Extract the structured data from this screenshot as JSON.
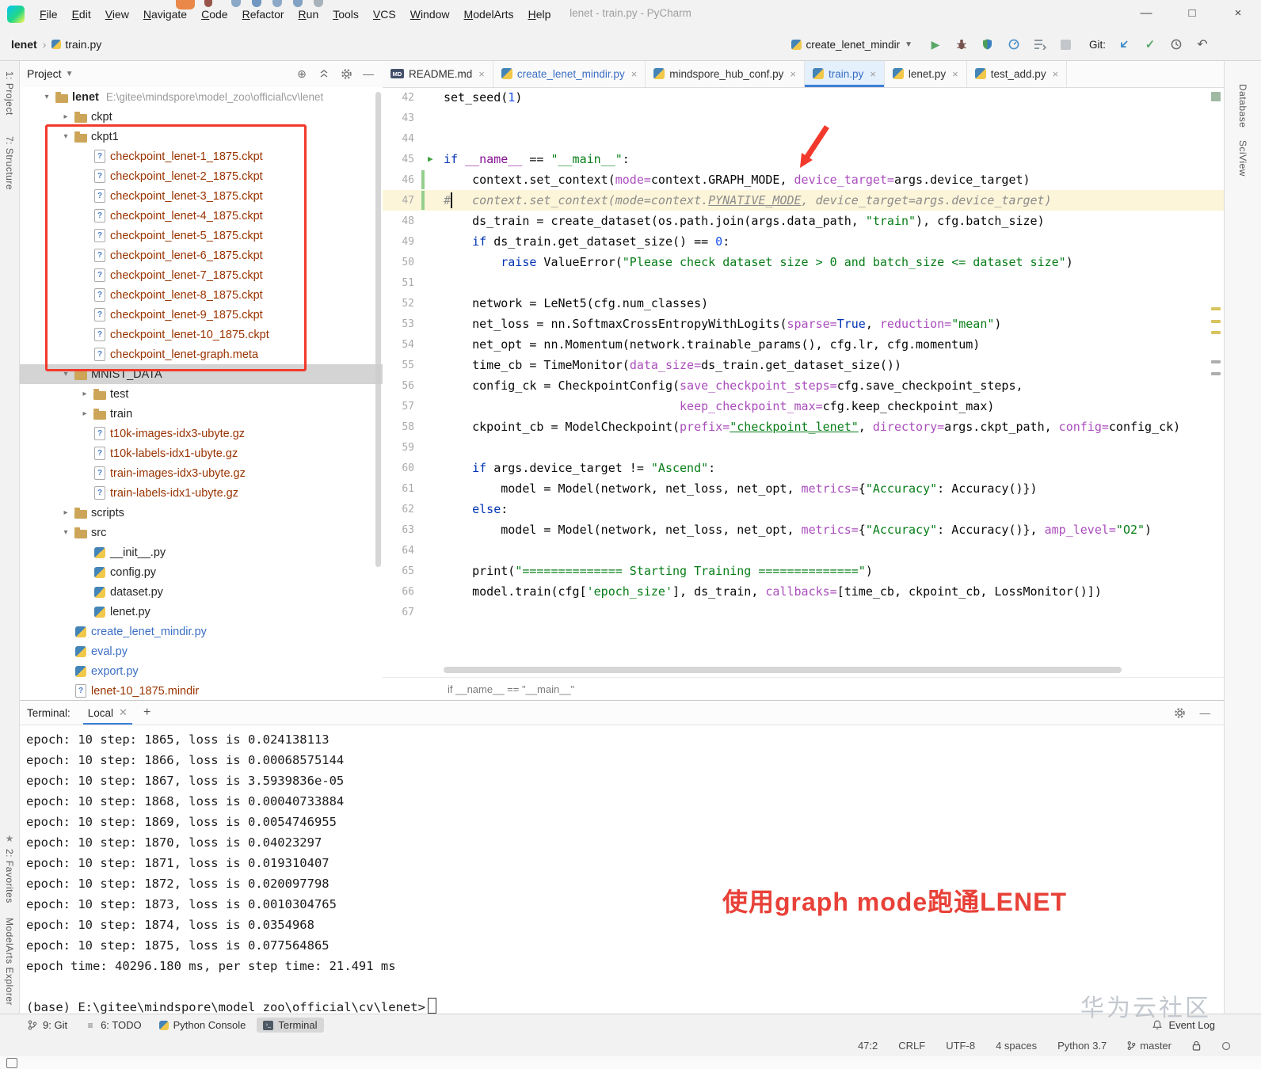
{
  "window": {
    "title": "lenet - train.py - PyCharm",
    "menus": [
      "File",
      "Edit",
      "View",
      "Navigate",
      "Code",
      "Refactor",
      "Run",
      "Tools",
      "VCS",
      "Window",
      "ModelArts",
      "Help"
    ],
    "controls": {
      "minimize": "—",
      "maximize": "□",
      "close": "×"
    }
  },
  "toolbar": {
    "project_crumb": "lenet",
    "file_crumb": "train.py",
    "run_config": "create_lenet_mindir",
    "git_label": "Git:"
  },
  "stripes": {
    "left_top": [
      "1: Project",
      "7: Structure"
    ],
    "left_bottom": [
      "2: Favorites",
      "ModelArts Explorer"
    ],
    "right": [
      "Database",
      "SciView"
    ]
  },
  "project_panel": {
    "title": "Project",
    "tree": [
      {
        "label": "lenet",
        "suffix": "E:\\gitee\\mindspore\\model_zoo\\official\\cv\\lenet",
        "level": 0,
        "icon": "folder",
        "arrow": "down",
        "bold": true
      },
      {
        "label": "ckpt",
        "level": 1,
        "icon": "folder",
        "arrow": "right"
      },
      {
        "label": "ckpt1",
        "level": 1,
        "icon": "folder",
        "arrow": "down"
      },
      {
        "label": "checkpoint_lenet-1_1875.ckpt",
        "level": 2,
        "icon": "fileq",
        "color": "brown"
      },
      {
        "label": "checkpoint_lenet-2_1875.ckpt",
        "level": 2,
        "icon": "fileq",
        "color": "brown"
      },
      {
        "label": "checkpoint_lenet-3_1875.ckpt",
        "level": 2,
        "icon": "fileq",
        "color": "brown"
      },
      {
        "label": "checkpoint_lenet-4_1875.ckpt",
        "level": 2,
        "icon": "fileq",
        "color": "brown"
      },
      {
        "label": "checkpoint_lenet-5_1875.ckpt",
        "level": 2,
        "icon": "fileq",
        "color": "brown"
      },
      {
        "label": "checkpoint_lenet-6_1875.ckpt",
        "level": 2,
        "icon": "fileq",
        "color": "brown"
      },
      {
        "label": "checkpoint_lenet-7_1875.ckpt",
        "level": 2,
        "icon": "fileq",
        "color": "brown"
      },
      {
        "label": "checkpoint_lenet-8_1875.ckpt",
        "level": 2,
        "icon": "fileq",
        "color": "brown"
      },
      {
        "label": "checkpoint_lenet-9_1875.ckpt",
        "level": 2,
        "icon": "fileq",
        "color": "brown"
      },
      {
        "label": "checkpoint_lenet-10_1875.ckpt",
        "level": 2,
        "icon": "fileq",
        "color": "brown"
      },
      {
        "label": "checkpoint_lenet-graph.meta",
        "level": 2,
        "icon": "fileq",
        "color": "brown"
      },
      {
        "label": "MNIST_DATA",
        "level": 1,
        "icon": "folder",
        "arrow": "down",
        "selected": true
      },
      {
        "label": "test",
        "level": 2,
        "icon": "folder",
        "arrow": "right"
      },
      {
        "label": "train",
        "level": 2,
        "icon": "folder",
        "arrow": "right"
      },
      {
        "label": "t10k-images-idx3-ubyte.gz",
        "level": 2,
        "icon": "fileq",
        "color": "brown"
      },
      {
        "label": "t10k-labels-idx1-ubyte.gz",
        "level": 2,
        "icon": "fileq",
        "color": "brown"
      },
      {
        "label": "train-images-idx3-ubyte.gz",
        "level": 2,
        "icon": "fileq",
        "color": "brown"
      },
      {
        "label": "train-labels-idx1-ubyte.gz",
        "level": 2,
        "icon": "fileq",
        "color": "brown"
      },
      {
        "label": "scripts",
        "level": 1,
        "icon": "folder",
        "arrow": "right"
      },
      {
        "label": "src",
        "level": 1,
        "icon": "folder",
        "arrow": "down"
      },
      {
        "label": "__init__.py",
        "level": 2,
        "icon": "py"
      },
      {
        "label": "config.py",
        "level": 2,
        "icon": "py"
      },
      {
        "label": "dataset.py",
        "level": 2,
        "icon": "py"
      },
      {
        "label": "lenet.py",
        "level": 2,
        "icon": "py"
      },
      {
        "label": "create_lenet_mindir.py",
        "level": 1,
        "icon": "py",
        "color": "blue"
      },
      {
        "label": "eval.py",
        "level": 1,
        "icon": "py",
        "color": "blue"
      },
      {
        "label": "export.py",
        "level": 1,
        "icon": "py",
        "color": "blue"
      },
      {
        "label": "lenet-10_1875.mindir",
        "level": 1,
        "icon": "fileq",
        "color": "brown"
      }
    ]
  },
  "editor": {
    "tabs": [
      {
        "label": "README.md",
        "icon": "md",
        "mod": false,
        "active": false
      },
      {
        "label": "create_lenet_mindir.py",
        "icon": "py",
        "mod": true,
        "active": false
      },
      {
        "label": "mindspore_hub_conf.py",
        "icon": "py",
        "mod": false,
        "active": false
      },
      {
        "label": "train.py",
        "icon": "py",
        "mod": true,
        "active": true
      },
      {
        "label": "lenet.py",
        "icon": "py",
        "mod": false,
        "active": false
      },
      {
        "label": "test_add.py",
        "icon": "py",
        "mod": false,
        "active": false
      }
    ],
    "current_line": 47,
    "run_line": 45,
    "changed_lines": [
      46,
      47
    ],
    "breadcrumb": "if __name__ == \"__main__\"",
    "lines": [
      {
        "n": 42,
        "t": [
          [
            "p",
            "set_seed("
          ],
          [
            "n",
            "1"
          ],
          [
            "p",
            ")"
          ]
        ]
      },
      {
        "n": 43,
        "t": []
      },
      {
        "n": 44,
        "t": []
      },
      {
        "n": 45,
        "t": [
          [
            "k",
            "if"
          ],
          [
            "p",
            " "
          ],
          [
            "d",
            "__name__"
          ],
          [
            "p",
            " == "
          ],
          [
            "s",
            "\"__main__\""
          ],
          [
            "p",
            ":"
          ]
        ]
      },
      {
        "n": 46,
        "t": [
          [
            "p",
            "    context.set_context("
          ],
          [
            "a",
            "mode="
          ],
          [
            "p",
            "context.GRAPH_MODE, "
          ],
          [
            "a",
            "device_target="
          ],
          [
            "p",
            "args.device_target)"
          ]
        ]
      },
      {
        "n": 47,
        "t": [
          [
            "c",
            "#   context.set_context(mode=context."
          ],
          [
            "cu",
            "PYNATIVE_MODE"
          ],
          [
            "c",
            ", device_target=args.device_target)"
          ]
        ]
      },
      {
        "n": 48,
        "t": [
          [
            "p",
            "    ds_train = create_dataset(os.path.join(args.data_path, "
          ],
          [
            "s",
            "\"train\""
          ],
          [
            "p",
            "), cfg.batch_size)"
          ]
        ]
      },
      {
        "n": 49,
        "t": [
          [
            "p",
            "    "
          ],
          [
            "k",
            "if"
          ],
          [
            "p",
            " ds_train.get_dataset_size() == "
          ],
          [
            "n",
            "0"
          ],
          [
            "p",
            ":"
          ]
        ]
      },
      {
        "n": 50,
        "t": [
          [
            "p",
            "        "
          ],
          [
            "k",
            "raise"
          ],
          [
            "p",
            " ValueError("
          ],
          [
            "s",
            "\"Please check dataset size > 0 and batch_size <= dataset size\""
          ],
          [
            "p",
            ")"
          ]
        ]
      },
      {
        "n": 51,
        "t": []
      },
      {
        "n": 52,
        "t": [
          [
            "p",
            "    network = LeNet5(cfg.num_classes)"
          ]
        ]
      },
      {
        "n": 53,
        "t": [
          [
            "p",
            "    net_loss = nn.SoftmaxCrossEntropyWithLogits("
          ],
          [
            "a",
            "sparse="
          ],
          [
            "k",
            "True"
          ],
          [
            "p",
            ", "
          ],
          [
            "a",
            "reduction="
          ],
          [
            "s",
            "\"mean\""
          ],
          [
            "p",
            ")"
          ]
        ]
      },
      {
        "n": 54,
        "t": [
          [
            "p",
            "    net_opt = nn.Momentum(network.trainable_params(), cfg.lr, cfg.momentum)"
          ]
        ]
      },
      {
        "n": 55,
        "t": [
          [
            "p",
            "    time_cb = TimeMonitor("
          ],
          [
            "a",
            "data_size="
          ],
          [
            "p",
            "ds_train.get_dataset_size())"
          ]
        ]
      },
      {
        "n": 56,
        "t": [
          [
            "p",
            "    config_ck = CheckpointConfig("
          ],
          [
            "a",
            "save_checkpoint_steps="
          ],
          [
            "p",
            "cfg.save_checkpoint_steps,"
          ]
        ]
      },
      {
        "n": 57,
        "t": [
          [
            "p",
            "                                 "
          ],
          [
            "a",
            "keep_checkpoint_max="
          ],
          [
            "p",
            "cfg.keep_checkpoint_max)"
          ]
        ]
      },
      {
        "n": 58,
        "t": [
          [
            "p",
            "    ckpoint_cb = ModelCheckpoint("
          ],
          [
            "a",
            "prefix="
          ],
          [
            "su",
            "\"checkpoint_lenet\""
          ],
          [
            "p",
            ", "
          ],
          [
            "a",
            "directory="
          ],
          [
            "p",
            "args.ckpt_path, "
          ],
          [
            "a",
            "config="
          ],
          [
            "p",
            "config_ck)"
          ]
        ]
      },
      {
        "n": 59,
        "t": []
      },
      {
        "n": 60,
        "t": [
          [
            "p",
            "    "
          ],
          [
            "k",
            "if"
          ],
          [
            "p",
            " args.device_target != "
          ],
          [
            "s",
            "\"Ascend\""
          ],
          [
            "p",
            ":"
          ]
        ]
      },
      {
        "n": 61,
        "t": [
          [
            "p",
            "        model = Model(network, net_loss, net_opt, "
          ],
          [
            "a",
            "metrics="
          ],
          [
            "p",
            "{"
          ],
          [
            "s",
            "\"Accuracy\""
          ],
          [
            "p",
            ": Accuracy()})"
          ]
        ]
      },
      {
        "n": 62,
        "t": [
          [
            "p",
            "    "
          ],
          [
            "k",
            "else"
          ],
          [
            "p",
            ":"
          ]
        ]
      },
      {
        "n": 63,
        "t": [
          [
            "p",
            "        model = Model(network, net_loss, net_opt, "
          ],
          [
            "a",
            "metrics="
          ],
          [
            "p",
            "{"
          ],
          [
            "s",
            "\"Accuracy\""
          ],
          [
            "p",
            ": Accuracy()}, "
          ],
          [
            "a",
            "amp_level="
          ],
          [
            "s",
            "\"O2\""
          ],
          [
            "p",
            ")"
          ]
        ]
      },
      {
        "n": 64,
        "t": []
      },
      {
        "n": 65,
        "t": [
          [
            "p",
            "    print("
          ],
          [
            "s",
            "\"============== Starting Training ==============\""
          ],
          [
            "p",
            ")"
          ]
        ]
      },
      {
        "n": 66,
        "t": [
          [
            "p",
            "    model.train(cfg["
          ],
          [
            "s",
            "'epoch_size'"
          ],
          [
            "p",
            "], ds_train, "
          ],
          [
            "a",
            "callbacks="
          ],
          [
            "p",
            "[time_cb, ckpoint_cb, LossMonitor()])"
          ]
        ]
      },
      {
        "n": 67,
        "t": []
      }
    ]
  },
  "terminal": {
    "label": "Terminal:",
    "tab": "Local",
    "lines": [
      "epoch: 10 step: 1865, loss is 0.024138113",
      "epoch: 10 step: 1866, loss is 0.00068575144",
      "epoch: 10 step: 1867, loss is 3.5939836e-05",
      "epoch: 10 step: 1868, loss is 0.00040733884",
      "epoch: 10 step: 1869, loss is 0.0054746955",
      "epoch: 10 step: 1870, loss is 0.04023297",
      "epoch: 10 step: 1871, loss is 0.019310407",
      "epoch: 10 step: 1872, loss is 0.020097798",
      "epoch: 10 step: 1873, loss is 0.0010304765",
      "epoch: 10 step: 1874, loss is 0.0354968",
      "epoch: 10 step: 1875, loss is 0.077564865",
      "epoch time: 40296.180 ms, per step time: 21.491 ms",
      "",
      "(base) E:\\gitee\\mindspore\\model_zoo\\official\\cv\\lenet>"
    ]
  },
  "annotations": {
    "callout": "使用graph mode跑通LENET",
    "watermark": "华为云社区",
    "accent_red": "#f2392c"
  },
  "bottom": {
    "tool_buttons": [
      "9: Git",
      "6: TODO",
      "Python Console",
      "Terminal"
    ],
    "active_tool": "Terminal",
    "event_log": "Event Log",
    "status": [
      "47:2",
      "CRLF",
      "UTF-8",
      "4 spaces",
      "Python 3.7",
      "master"
    ]
  },
  "icons": {
    "run": "play-icon",
    "debug": "bug-icon",
    "coverage": "shield-icon",
    "profiler": "profiler-icon",
    "stop": "stop-icon",
    "update": "arrow-down-left-icon",
    "commit": "check-icon",
    "history": "clock-icon",
    "revert": "undo-icon",
    "bell": "bell-icon",
    "branch": "git-branch-icon",
    "lock": "lock-icon",
    "gear": "gear-icon"
  }
}
